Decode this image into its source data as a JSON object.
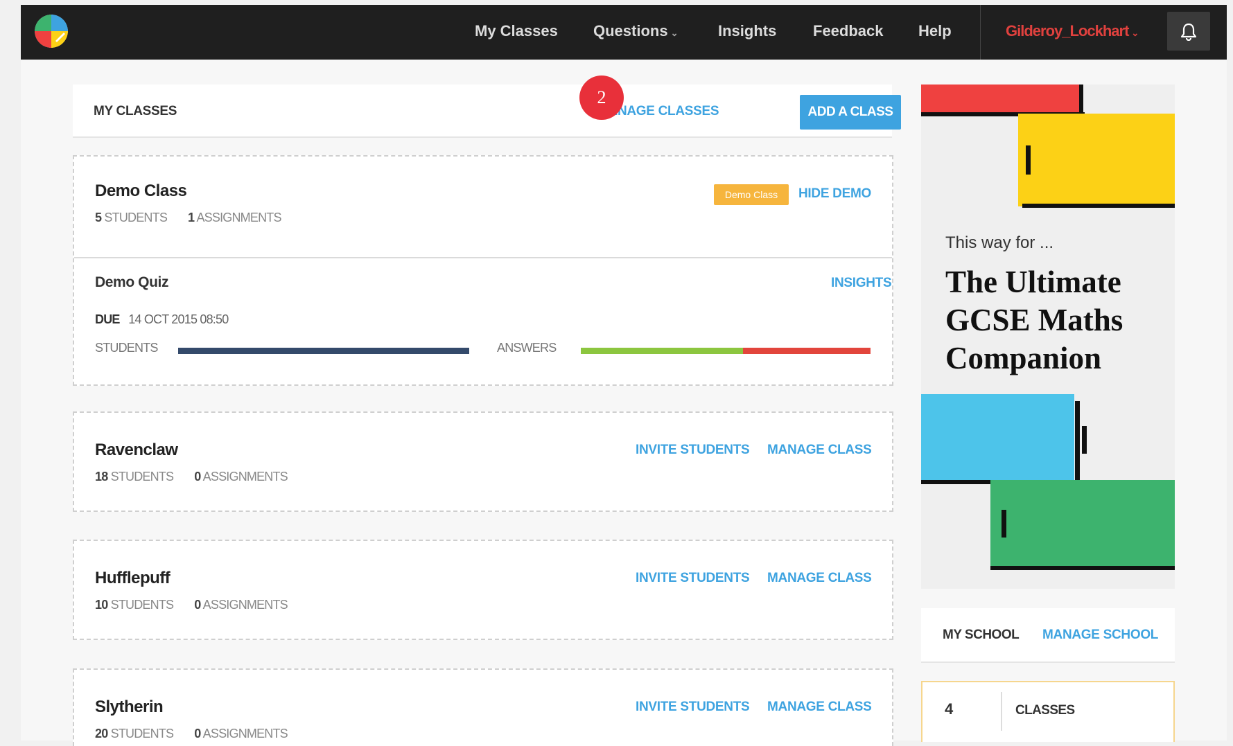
{
  "nav": {
    "links": [
      "My Classes",
      "Questions",
      "Insights",
      "Feedback",
      "Help"
    ],
    "caret": "⌄",
    "user": "Gilderoy_Lockhart",
    "bell_icon": "bell-icon"
  },
  "header": {
    "title": "MY CLASSES",
    "step_badge": "2",
    "manage_classes": "MANAGE CLASSES",
    "add_class": "ADD A CLASS"
  },
  "classes": [
    {
      "name": "Demo Class",
      "students_count": "5",
      "students_label": "STUDENTS",
      "assignments_count": "1",
      "assignments_label": "ASSIGNMENTS",
      "tag": "Demo Class",
      "action": "HIDE DEMO"
    },
    {
      "name": "Ravenclaw",
      "students_count": "18",
      "students_label": "STUDENTS",
      "assignments_count": "0",
      "assignments_label": "ASSIGNMENTS",
      "invite": "INVITE STUDENTS",
      "manage": "MANAGE CLASS"
    },
    {
      "name": "Hufflepuff",
      "students_count": "10",
      "students_label": "STUDENTS",
      "assignments_count": "0",
      "assignments_label": "ASSIGNMENTS",
      "invite": "INVITE STUDENTS",
      "manage": "MANAGE CLASS"
    },
    {
      "name": "Slytherin",
      "students_count": "20",
      "students_label": "STUDENTS",
      "assignments_count": "0",
      "assignments_label": "ASSIGNMENTS",
      "invite": "INVITE STUDENTS",
      "manage": "MANAGE CLASS"
    }
  ],
  "quiz": {
    "title": "Demo Quiz",
    "insights": "INSIGHTS",
    "due_label": "DUE",
    "due_value": "14 OCT 2015 08:50",
    "students_label": "STUDENTS",
    "answers_label": "ANSWERS",
    "students_progress": 1.0,
    "answers_correct_fraction": 0.56,
    "answers_incorrect_fraction": 0.44
  },
  "promo": {
    "for_text": "This way for ...",
    "title": "The Ultimate GCSE Maths Companion"
  },
  "school": {
    "title": "MY SCHOOL",
    "manage": "MANAGE SCHOOL",
    "classes_count": "4",
    "classes_label": "CLASSES"
  },
  "colors": {
    "nav_bg": "#1f1f1f",
    "accent_blue": "#3ea3e0",
    "user_red": "#e0413e",
    "badge_red": "#e8303a",
    "demo_tag": "#f6b53d",
    "bar_students": "#344a6b",
    "bar_correct": "#8cc63f",
    "bar_incorrect": "#e2453c",
    "promo_red": "#ef4140",
    "promo_yellow": "#fcd116",
    "promo_blue": "#4dc4ea",
    "promo_green": "#3db36e"
  }
}
